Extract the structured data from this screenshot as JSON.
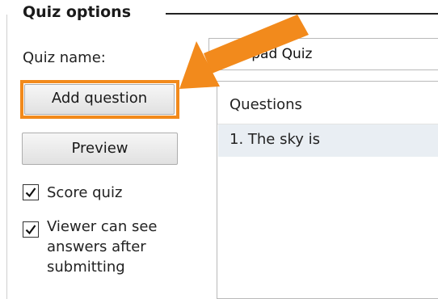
{
  "group": {
    "title": "Quiz options"
  },
  "quiz_name": {
    "label": "Quiz name:",
    "value": "Notepad Quiz"
  },
  "buttons": {
    "add_question": "Add question",
    "preview": "Preview"
  },
  "options": [
    {
      "label_lines": [
        "Score quiz"
      ],
      "checked": true
    },
    {
      "label_lines": [
        "Viewer can see",
        "answers after",
        "submitting"
      ],
      "checked": true
    }
  ],
  "questions": {
    "header": "Questions",
    "items": [
      "1. The sky is"
    ]
  },
  "annotation": {
    "color": "#f28a1c",
    "icon": "arrow-icon"
  }
}
